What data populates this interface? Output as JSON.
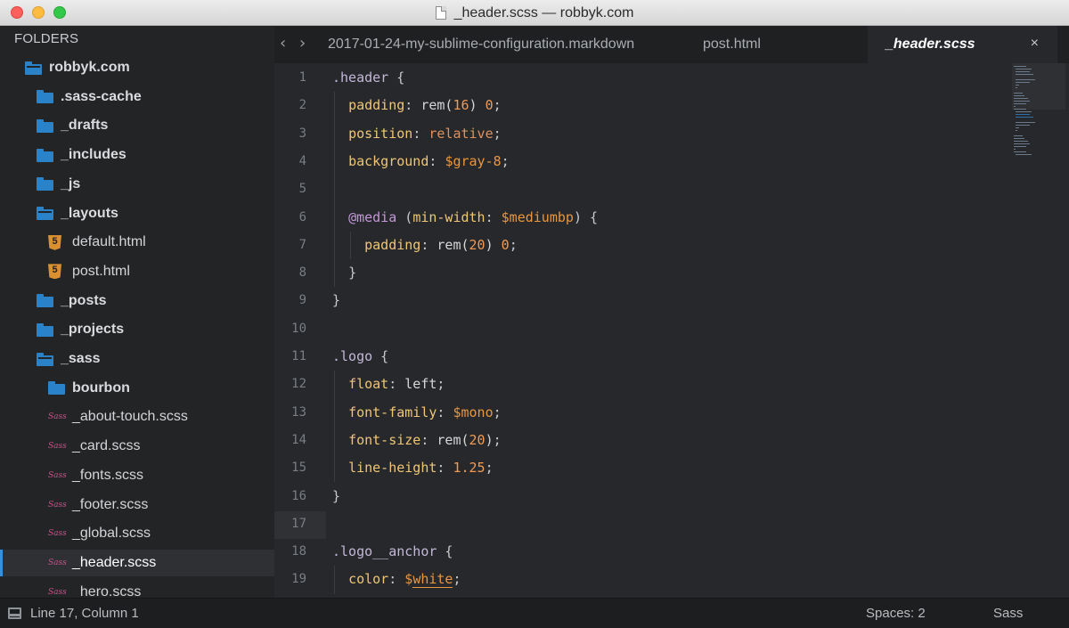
{
  "window": {
    "title": "_header.scss — robbyk.com"
  },
  "sidebar": {
    "header": "FOLDERS",
    "items": [
      {
        "label": "robbyk.com",
        "type": "folder-open",
        "depth": 0,
        "bold": true
      },
      {
        "label": ".sass-cache",
        "type": "folder",
        "depth": 1,
        "bold": true
      },
      {
        "label": "_drafts",
        "type": "folder",
        "depth": 1,
        "bold": true
      },
      {
        "label": "_includes",
        "type": "folder",
        "depth": 1,
        "bold": true
      },
      {
        "label": "_js",
        "type": "folder",
        "depth": 1,
        "bold": true
      },
      {
        "label": "_layouts",
        "type": "folder-open",
        "depth": 1,
        "bold": true
      },
      {
        "label": "default.html",
        "type": "html",
        "depth": 2,
        "bold": false
      },
      {
        "label": "post.html",
        "type": "html",
        "depth": 2,
        "bold": false
      },
      {
        "label": "_posts",
        "type": "folder",
        "depth": 1,
        "bold": true
      },
      {
        "label": "_projects",
        "type": "folder",
        "depth": 1,
        "bold": true
      },
      {
        "label": "_sass",
        "type": "folder-open",
        "depth": 1,
        "bold": true
      },
      {
        "label": "bourbon",
        "type": "folder",
        "depth": 2,
        "bold": true
      },
      {
        "label": "_about-touch.scss",
        "type": "sass",
        "depth": 2,
        "bold": false
      },
      {
        "label": "_card.scss",
        "type": "sass",
        "depth": 2,
        "bold": false
      },
      {
        "label": "_fonts.scss",
        "type": "sass",
        "depth": 2,
        "bold": false
      },
      {
        "label": "_footer.scss",
        "type": "sass",
        "depth": 2,
        "bold": false
      },
      {
        "label": "_global.scss",
        "type": "sass",
        "depth": 2,
        "bold": false
      },
      {
        "label": "_header.scss",
        "type": "sass",
        "depth": 2,
        "bold": false,
        "selected": true
      },
      {
        "label": "_hero.scss",
        "type": "sass",
        "depth": 2,
        "bold": false
      }
    ]
  },
  "tabs": [
    {
      "label": "2017-01-24-my-sublime-configuration.markdown",
      "active": false
    },
    {
      "label": "post.html",
      "active": false
    },
    {
      "label": "_header.scss",
      "active": true
    }
  ],
  "tab_close_glyph": "×",
  "nav": {
    "back": "‹",
    "forward": "›"
  },
  "editor": {
    "current_line": 17,
    "lines": [
      {
        "n": "1",
        "tokens": [
          [
            "sel",
            ".header"
          ],
          [
            "punc",
            " {"
          ]
        ]
      },
      {
        "n": "2",
        "tokens": [
          [
            "plain",
            "  "
          ],
          [
            "prop",
            "padding"
          ],
          [
            "punc",
            ": "
          ],
          [
            "fn",
            "rem("
          ],
          [
            "num",
            "16"
          ],
          [
            "fn",
            ") "
          ],
          [
            "num",
            "0"
          ],
          [
            "punc",
            ";"
          ]
        ]
      },
      {
        "n": "3",
        "tokens": [
          [
            "plain",
            "  "
          ],
          [
            "prop",
            "position"
          ],
          [
            "punc",
            ": "
          ],
          [
            "val",
            "relative"
          ],
          [
            "punc",
            ";"
          ]
        ]
      },
      {
        "n": "4",
        "tokens": [
          [
            "plain",
            "  "
          ],
          [
            "prop",
            "background"
          ],
          [
            "punc",
            ": "
          ],
          [
            "var",
            "$gray-8"
          ],
          [
            "punc",
            ";"
          ]
        ]
      },
      {
        "n": "5",
        "tokens": []
      },
      {
        "n": "6",
        "tokens": [
          [
            "plain",
            "  "
          ],
          [
            "kw",
            "@media"
          ],
          [
            "punc",
            " ("
          ],
          [
            "prop",
            "min-width"
          ],
          [
            "punc",
            ": "
          ],
          [
            "var",
            "$mediumbp"
          ],
          [
            "punc",
            ") {"
          ]
        ]
      },
      {
        "n": "7",
        "tokens": [
          [
            "plain",
            "    "
          ],
          [
            "prop",
            "padding"
          ],
          [
            "punc",
            ": "
          ],
          [
            "fn",
            "rem("
          ],
          [
            "num",
            "20"
          ],
          [
            "fn",
            ") "
          ],
          [
            "num",
            "0"
          ],
          [
            "punc",
            ";"
          ]
        ]
      },
      {
        "n": "8",
        "tokens": [
          [
            "plain",
            "  "
          ],
          [
            "punc",
            "}"
          ]
        ]
      },
      {
        "n": "9",
        "tokens": [
          [
            "punc",
            "}"
          ]
        ]
      },
      {
        "n": "10",
        "tokens": []
      },
      {
        "n": "11",
        "tokens": [
          [
            "sel",
            ".logo"
          ],
          [
            "punc",
            " {"
          ]
        ]
      },
      {
        "n": "12",
        "tokens": [
          [
            "plain",
            "  "
          ],
          [
            "prop",
            "float"
          ],
          [
            "punc",
            ": "
          ],
          [
            "plain",
            "left"
          ],
          [
            "punc",
            ";"
          ]
        ]
      },
      {
        "n": "13",
        "tokens": [
          [
            "plain",
            "  "
          ],
          [
            "prop",
            "font-family"
          ],
          [
            "punc",
            ": "
          ],
          [
            "var",
            "$mono"
          ],
          [
            "punc",
            ";"
          ]
        ]
      },
      {
        "n": "14",
        "tokens": [
          [
            "plain",
            "  "
          ],
          [
            "prop",
            "font-size"
          ],
          [
            "punc",
            ": "
          ],
          [
            "fn",
            "rem("
          ],
          [
            "num",
            "20"
          ],
          [
            "fn",
            ")"
          ],
          [
            "punc",
            ";"
          ]
        ]
      },
      {
        "n": "15",
        "tokens": [
          [
            "plain",
            "  "
          ],
          [
            "prop",
            "line-height"
          ],
          [
            "punc",
            ": "
          ],
          [
            "num",
            "1.25"
          ],
          [
            "punc",
            ";"
          ]
        ]
      },
      {
        "n": "16",
        "tokens": [
          [
            "punc",
            "}"
          ]
        ]
      },
      {
        "n": "17",
        "tokens": []
      },
      {
        "n": "18",
        "tokens": [
          [
            "sel",
            ".logo__anchor"
          ],
          [
            "punc",
            " {"
          ]
        ]
      },
      {
        "n": "19",
        "tokens": [
          [
            "plain",
            "  "
          ],
          [
            "prop",
            "color"
          ],
          [
            "punc",
            ": "
          ],
          [
            "var",
            "$"
          ],
          [
            "var-u",
            "white"
          ],
          [
            "punc",
            ";"
          ]
        ]
      }
    ]
  },
  "status": {
    "position": "Line 17, Column 1",
    "indent": "Spaces: 2",
    "syntax": "Sass"
  },
  "colors": {
    "accent": "#3a8fd6",
    "folder": "#2a82c8",
    "sass": "#c6538c",
    "html": "#d9902f"
  }
}
